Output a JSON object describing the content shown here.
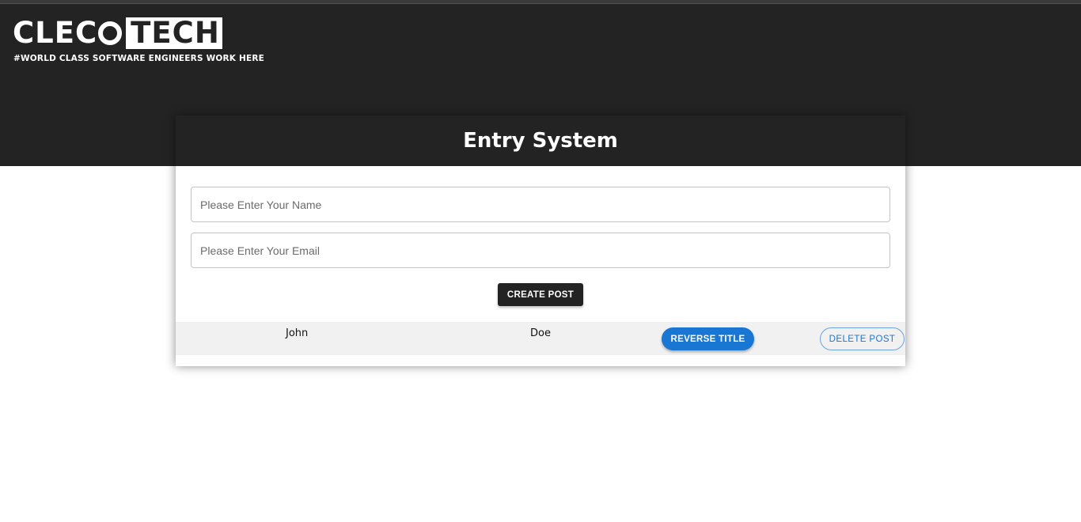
{
  "brand": {
    "logo_left": "CLEC",
    "logo_right": "TECH",
    "tagline": "#WORLD CLASS SOFTWARE ENGINEERS WORK HERE"
  },
  "form": {
    "title": "Entry System",
    "name_placeholder": "Please Enter Your Name",
    "name_value": "",
    "email_placeholder": "Please Enter Your Email",
    "email_value": "",
    "create_label": "CREATE POST"
  },
  "posts": [
    {
      "first": "John",
      "last": "Doe",
      "reverse_label": "REVERSE TITLE",
      "delete_label": "DELETE POST"
    }
  ],
  "colors": {
    "dark": "#232323",
    "accent": "#1976d2",
    "row_bg": "#f1f1f1"
  }
}
